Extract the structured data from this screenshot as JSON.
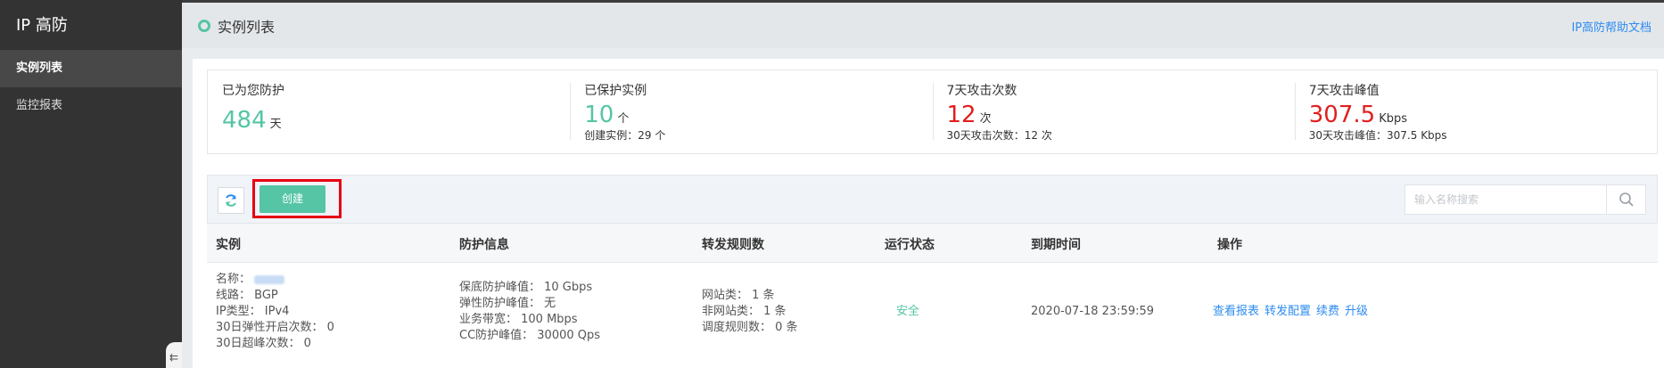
{
  "sidebar": {
    "brand": "IP 高防",
    "items": [
      {
        "label": "实例列表"
      },
      {
        "label": "监控报表"
      }
    ],
    "collapse_glyph": "⇇"
  },
  "header": {
    "title": "实例列表",
    "help_link": "IP高防帮助文档"
  },
  "stats": [
    {
      "label": "已为您防护",
      "value": "484",
      "unit": "天",
      "sub": ""
    },
    {
      "label": "已保护实例",
      "value": "10",
      "unit": "个",
      "sub": "创建实例：29 个"
    },
    {
      "label": "7天攻击次数",
      "value": "12",
      "unit": "次",
      "sub": "30天攻击次数：12 次"
    },
    {
      "label": "7天攻击峰值",
      "value": "307.5",
      "unit": "Kbps",
      "sub": "30天攻击峰值：307.5 Kbps"
    }
  ],
  "toolbar": {
    "create_label": "创建",
    "search_placeholder": "输入名称搜索",
    "refresh_icon": "refresh-icon",
    "search_icon": "search-icon"
  },
  "table": {
    "headers": [
      "实例",
      "防护信息",
      "转发规则数",
      "运行状态",
      "到期时间",
      "操作"
    ],
    "rows": [
      {
        "instance": {
          "name_label": "名称：",
          "line": "线路：  BGP",
          "ip_type": "IP类型：  IPv4",
          "elastic_count": "30日弹性开启次数：  0",
          "overpeak_count": "30日超峰次数：  0"
        },
        "protection": {
          "base": "保底防护峰值：  10 Gbps",
          "elastic": "弹性防护峰值：  无",
          "bandwidth": "业务带宽：  100 Mbps",
          "cc": "CC防护峰值：  30000 Qps"
        },
        "rules": {
          "site": "网站类：  1 条",
          "nonsite": "非网站类：  1 条",
          "schedule": "调度规则数：  0 条"
        },
        "status": "安全",
        "expire": "2020-07-18 23:59:59",
        "ops": [
          "查看报表",
          "转发配置",
          "续费",
          "升级"
        ]
      }
    ]
  },
  "colors": {
    "accent": "#55c5a5",
    "link": "#2d8cf0",
    "alert": "#e11f1f",
    "sidebar_bg": "#333333",
    "highlight_box": "#e60012"
  }
}
